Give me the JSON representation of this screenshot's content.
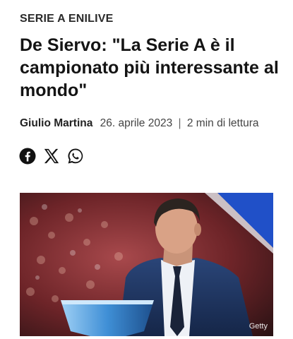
{
  "article": {
    "category": "SERIE A ENILIVE",
    "headline": "De Siervo: \"La Serie A è il campionato più interessante al mondo\"",
    "author": "Giulio Martina",
    "date": "26. aprile 2023",
    "separator": "|",
    "reading_time": "2 min di lettura"
  },
  "share": {
    "icons": [
      "facebook-icon",
      "x-icon",
      "whatsapp-icon"
    ]
  },
  "image": {
    "credit": "Getty",
    "description_colors": {
      "crowd": "#7a2a2e",
      "suit": "#1f3566",
      "trophy": "#5aa6e8",
      "accent": "#2050c8"
    }
  }
}
